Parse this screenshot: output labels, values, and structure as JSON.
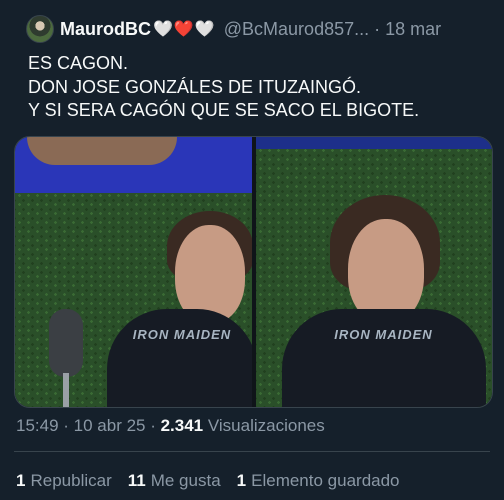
{
  "tweet": {
    "author_name": "MaurodBC",
    "author_emoji": "🤍❤️🤍",
    "handle": "@BcMaurod857...",
    "separator": "·",
    "date": "18 mar",
    "text_lines": [
      "ES CAGON.",
      "DON JOSE GONZÁLES DE ITUZAINGÓ.",
      "Y SI SERA  CAGÓN QUE SE SACO EL BIGOTE."
    ],
    "media": {
      "left_shirt_text": "IRON MAIDEN",
      "right_shirt_text": "IRON MAIDEN"
    },
    "meta": {
      "time_date": "15:49 · 10 abr 25 · ",
      "views_count": "2.341",
      "views_label": " Visualizaciones"
    },
    "stats": {
      "reposts_count": "1",
      "reposts_label": "Republicar",
      "likes_count": "11",
      "likes_label": "Me gusta",
      "bookmarks_count": "1",
      "bookmarks_label": "Elemento guardado"
    }
  },
  "colors": {
    "background": "#15202b",
    "text": "#f7f9f9",
    "secondary": "#8b98a5",
    "border": "#38444d"
  }
}
